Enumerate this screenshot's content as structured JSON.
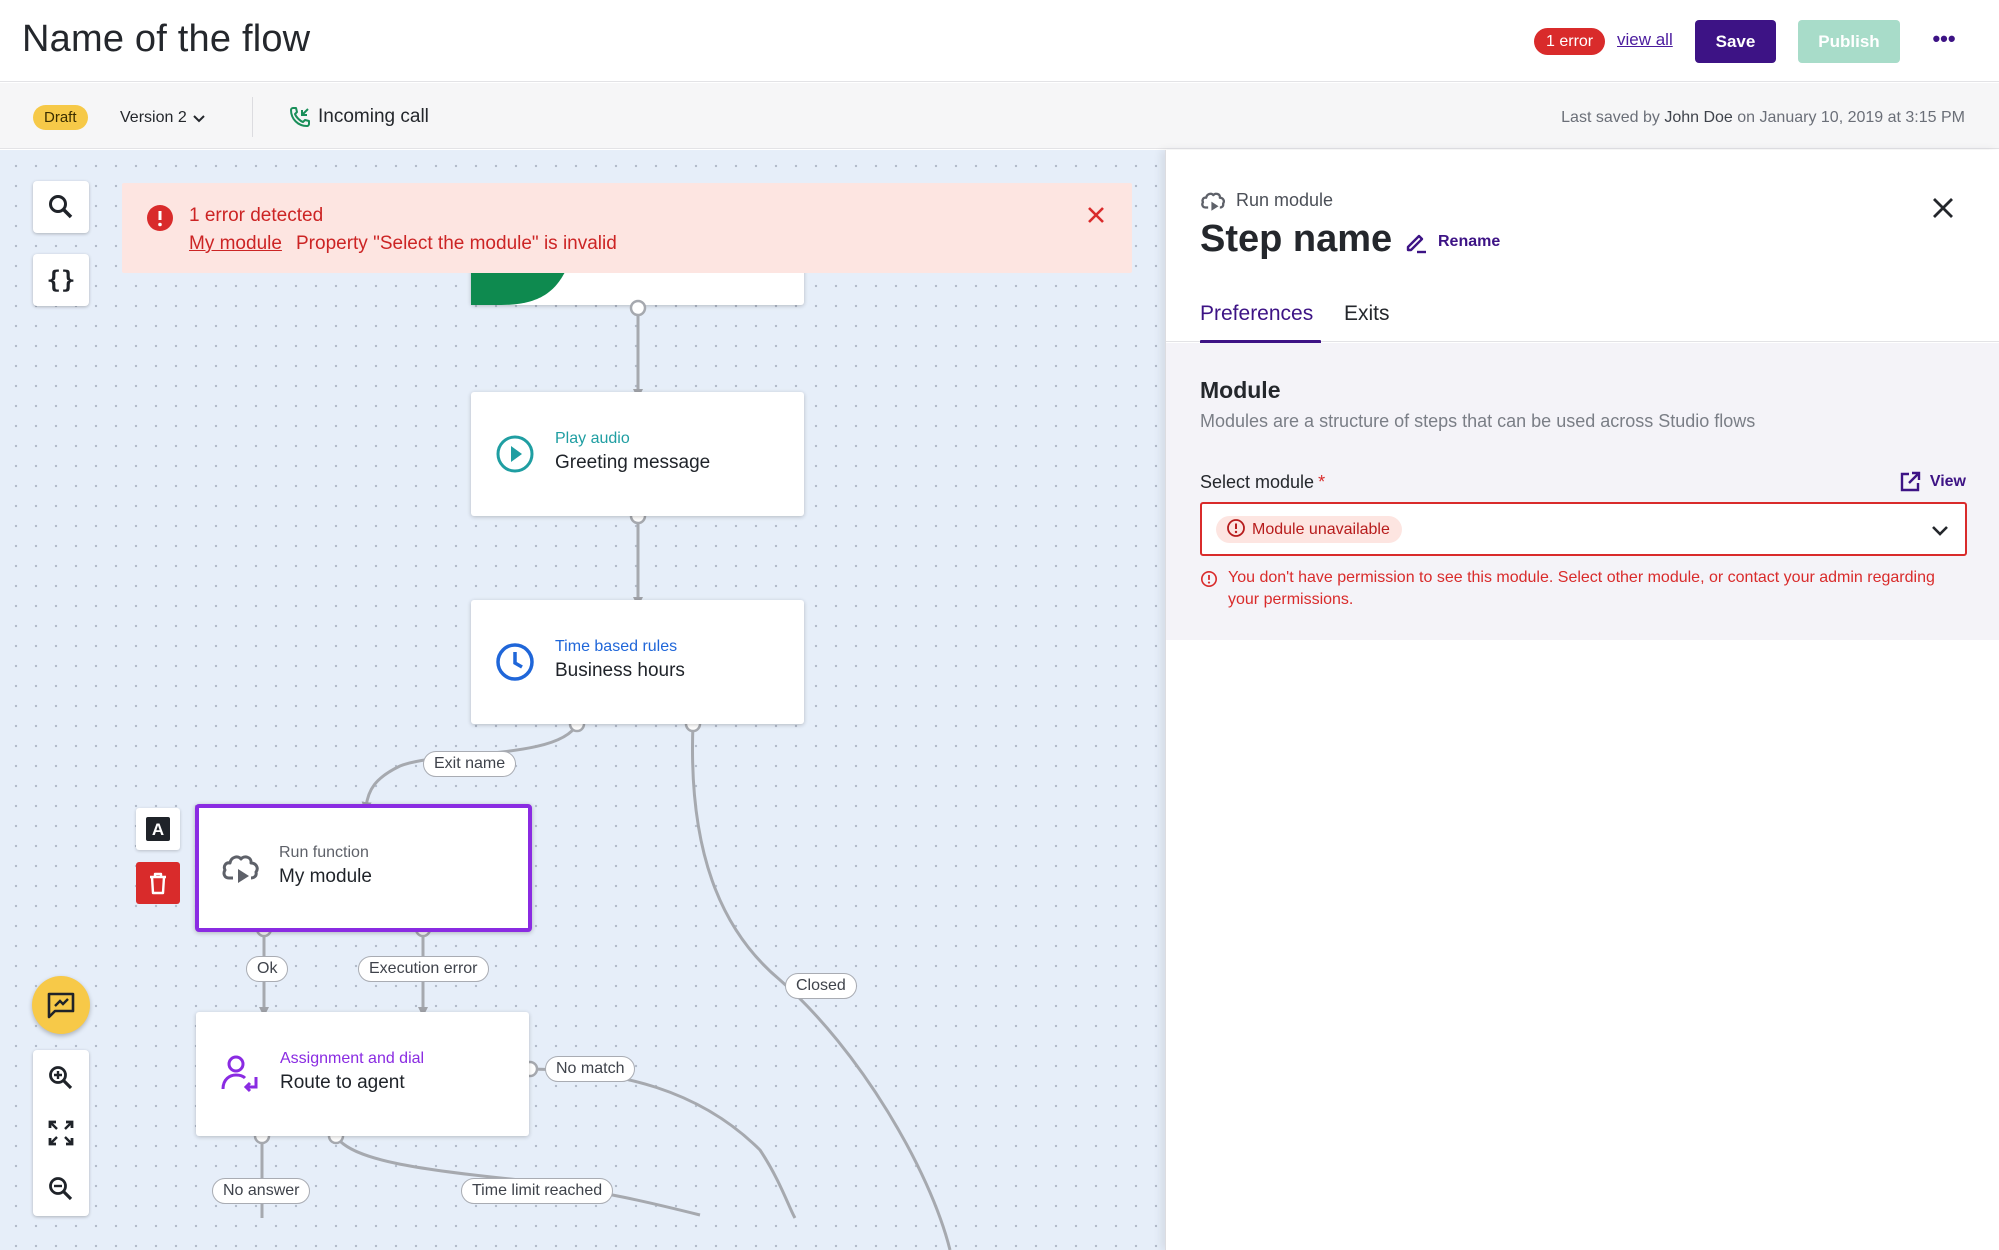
{
  "header": {
    "title": "Name of the flow",
    "error_badge": "1 error",
    "view_all": "view all",
    "save_label": "Save",
    "publish_label": "Publish",
    "more_label": "•••"
  },
  "subheader": {
    "status": "Draft",
    "version": "Version 2",
    "trigger": "Incoming call",
    "saved_prefix": "Last saved by",
    "saved_by": "John Doe",
    "saved_on": "on January 10, 2019 at 3:15 PM"
  },
  "canvas": {
    "tools": {
      "search_icon": "search-icon",
      "variables_label": "{}"
    },
    "error_banner": {
      "title": "1 error detected",
      "link": "My module",
      "message": "Property \"Select the module\" is invalid"
    },
    "nodes": {
      "play_audio": {
        "type": "Play audio",
        "name": "Greeting message",
        "color": "#1f9ea2"
      },
      "time_rules": {
        "type": "Time based rules",
        "name": "Business hours",
        "color": "#1f66d9"
      },
      "run_function": {
        "type": "Run function",
        "name": "My module",
        "color": "#5e6169"
      },
      "assignment": {
        "type": "Assignment and dial",
        "name": "Route to agent",
        "color": "#8a2be2"
      }
    },
    "edge_labels": {
      "exit_name": "Exit name",
      "ok": "Ok",
      "execution_error": "Execution error",
      "closed": "Closed",
      "no_match": "No match",
      "no_answer": "No answer",
      "time_limit": "Time limit reached"
    },
    "node_tools": {
      "rename_glyph": "A"
    }
  },
  "panel": {
    "kind": "Run module",
    "title": "Step name",
    "rename": "Rename",
    "tabs": [
      "Preferences",
      "Exits"
    ],
    "section_title": "Module",
    "section_desc": "Modules are a structure of steps that can be used across Studio flows",
    "field_label": "Select module",
    "required_mark": "*",
    "view_link": "View",
    "selected_value": "Module unavailable",
    "error_text": "You don't have permission to see this module.  Select other module, or contact your admin regarding your permissions."
  },
  "colors": {
    "brand": "#3d1385",
    "error": "#d92b2b",
    "publish_disabled": "#a8dcc9",
    "draft": "#f6c948",
    "canvas_bg": "#e6eef9"
  }
}
